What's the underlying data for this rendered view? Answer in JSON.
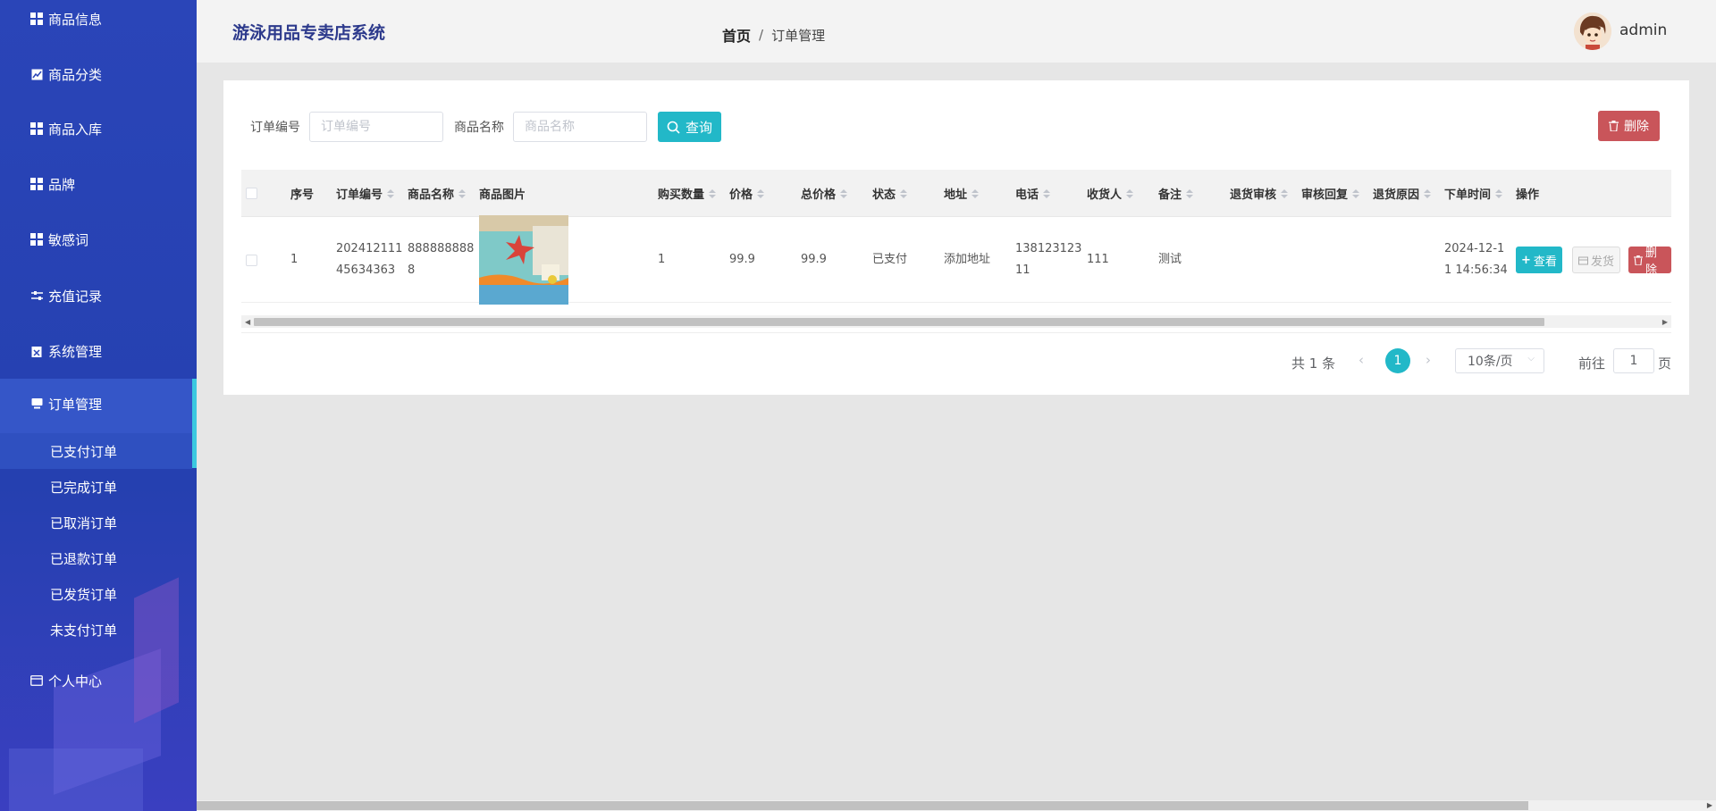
{
  "app": {
    "title": "游泳用品专卖店系统"
  },
  "breadcrumb": {
    "home": "首页",
    "separator": "/",
    "current": "订单管理"
  },
  "user": {
    "name": "admin"
  },
  "sidebar": {
    "items": [
      {
        "label": "商品信息",
        "icon": "grid-icon"
      },
      {
        "label": "商品分类",
        "icon": "chart-icon"
      },
      {
        "label": "商品入库",
        "icon": "grid-icon"
      },
      {
        "label": "品牌",
        "icon": "grid-icon"
      },
      {
        "label": "敏感词",
        "icon": "grid-icon"
      },
      {
        "label": "充值记录",
        "icon": "sliders-icon"
      },
      {
        "label": "系统管理",
        "icon": "clipboard-icon"
      },
      {
        "label": "订单管理",
        "icon": "monitor-icon"
      },
      {
        "label": "个人中心",
        "icon": "card-icon"
      }
    ],
    "sub_items": [
      "已支付订单",
      "已完成订单",
      "已取消订单",
      "已退款订单",
      "已发货订单",
      "未支付订单"
    ]
  },
  "search": {
    "order_no_label": "订单编号",
    "order_no_placeholder": "订单编号",
    "product_name_label": "商品名称",
    "product_name_placeholder": "商品名称",
    "query_button": "查询",
    "delete_button": "删除"
  },
  "table": {
    "headers": [
      "序号",
      "订单编号",
      "商品名称",
      "商品图片",
      "购买数量",
      "价格",
      "总价格",
      "状态",
      "地址",
      "电话",
      "收货人",
      "备注",
      "退货审核",
      "审核回复",
      "退货原因",
      "下单时间",
      "操作"
    ],
    "rows": [
      {
        "index": "1",
        "order_no": "2024121114 5634363",
        "order_no_l1": "202412111",
        "order_no_l2": "45634363",
        "product_name_l1": "888888888",
        "product_name_l2": "8",
        "quantity": "1",
        "price": "99.9",
        "total": "99.9",
        "status": "已支付",
        "address": "添加地址",
        "phone_l1": "138123123",
        "phone_l2": "11",
        "receiver": "111",
        "note": "测试",
        "return_review": "",
        "review_reply": "",
        "return_reason": "",
        "time_l1": "2024-12-1",
        "time_l2": "1 14:56:34",
        "actions": {
          "view": "查看",
          "ship": "发货",
          "delete": "删除"
        }
      }
    ]
  },
  "pagination": {
    "total_text": "共 1 条",
    "current_page": "1",
    "page_size": "10条/页",
    "goto_label": "前往",
    "goto_value": "1",
    "page_suffix": "页"
  },
  "colors": {
    "sidebar": "#2a45b8",
    "accent": "#22b8c8",
    "danger": "#c9555a",
    "title": "#2d3a8c"
  }
}
